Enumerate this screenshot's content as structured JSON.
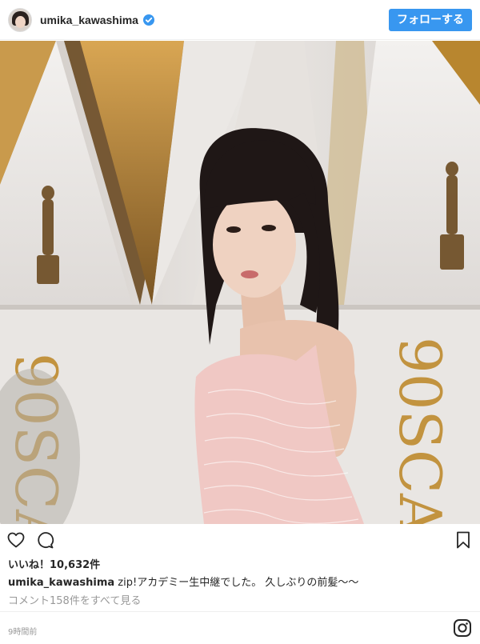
{
  "header": {
    "username": "umika_kawashima",
    "verified": true,
    "follow_label": "フォローする",
    "accent_color": "#3897f0"
  },
  "post": {
    "photo_description_icon": "photo",
    "oscars_text_left": "90SCA",
    "oscars_text_right": "90SCA",
    "colors": {
      "backdrop": "#d8d3cf",
      "gold": "#b8862f",
      "dress": "#f0c8c4",
      "hair": "#1f1716"
    }
  },
  "actions": {
    "like_icon": "heart-icon",
    "comment_icon": "comment-icon",
    "save_icon": "bookmark-icon"
  },
  "likes": {
    "label": "いいね！10,632件"
  },
  "caption": {
    "username": "umika_kawashima",
    "text": "zip!アカデミー生中継でした。 久しぶりの前髪〜〜"
  },
  "comments": {
    "link_label": "コメント158件をすべて見る"
  },
  "meta": {
    "timestamp": "9時間前",
    "brand_icon": "instagram-icon"
  }
}
